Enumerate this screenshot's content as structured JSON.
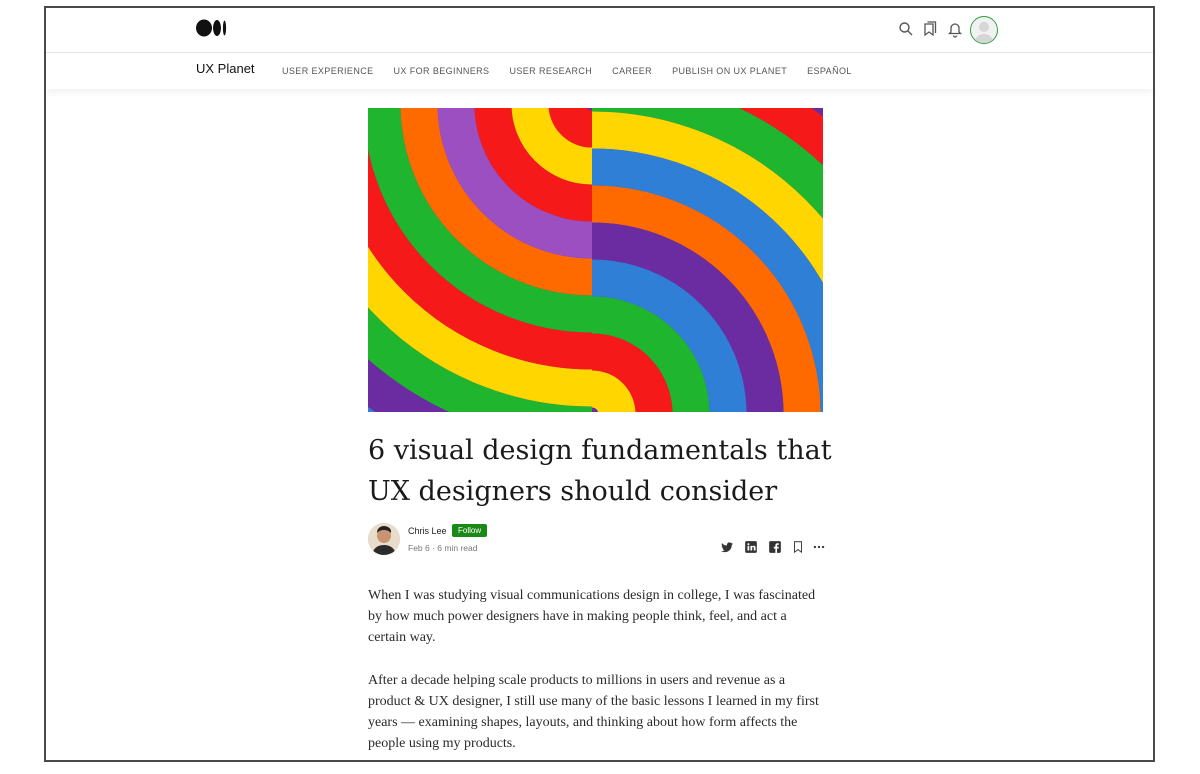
{
  "header": {
    "icons": [
      "medium-logo",
      "search-icon",
      "bookmarks-icon",
      "bell-icon",
      "avatar"
    ]
  },
  "publication": {
    "name": "UX Planet",
    "nav": [
      "USER EXPERIENCE",
      "UX FOR BEGINNERS",
      "USER RESEARCH",
      "CAREER",
      "PUBLISH ON UX PLANET",
      "ESPAÑOL"
    ]
  },
  "article": {
    "title": "6 visual design fundamentals that UX designers should consider",
    "author": "Chris Lee",
    "follow_label": "Follow",
    "meta": "Feb 6 · 6 min read",
    "share_icons": [
      "twitter-icon",
      "linkedin-icon",
      "facebook-icon",
      "bookmark-icon",
      "more-icon"
    ],
    "paragraphs": [
      "When I was studying visual communications design in college, I was fascinated by how much power designers have in making people think, feel, and act a certain way.",
      "After a decade helping scale products to millions in users and revenue as a product & UX designer, I still use many of the basic lessons I learned in my first years — examining shapes, layouts, and thinking about how form affects the people using my products."
    ]
  },
  "colors": {
    "accent_green": "#1a8917",
    "rainbow": [
      "#6a2ca0",
      "#2f7fd6",
      "#1fb52e",
      "#ffd600",
      "#ff6a00",
      "#f51919"
    ]
  }
}
